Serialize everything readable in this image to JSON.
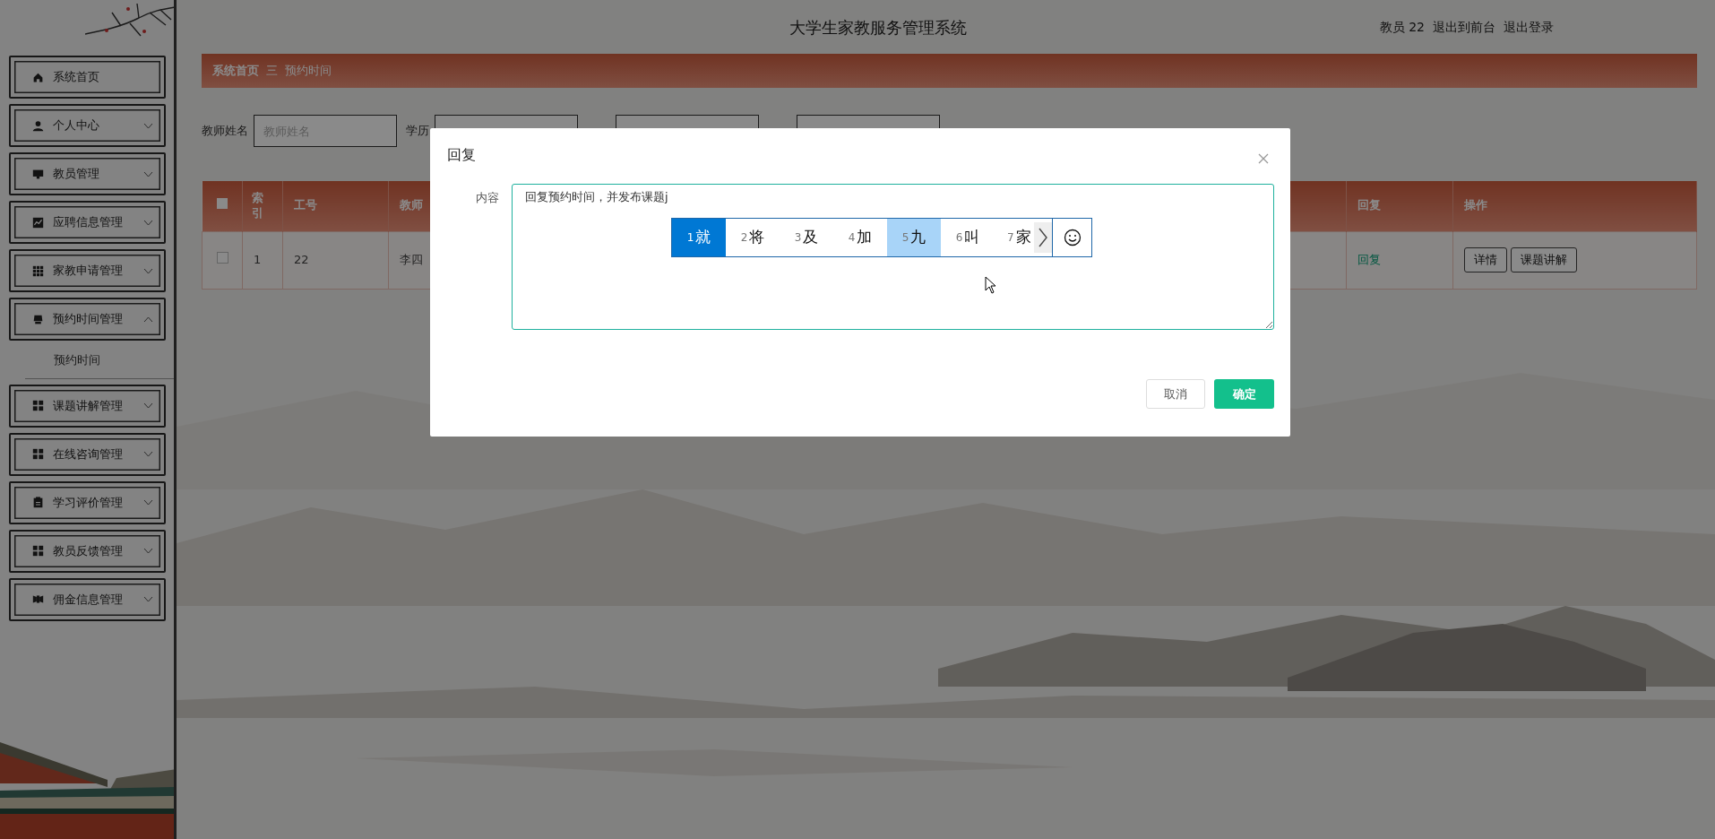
{
  "header": {
    "title": "大学生家教服务管理系统",
    "user": "教员 22",
    "links": [
      "退出到前台",
      "退出登录"
    ]
  },
  "sidebar": {
    "items": [
      {
        "kind": "link",
        "label": "系统首页"
      },
      {
        "kind": "menu",
        "label": "个人中心",
        "expanded": false
      },
      {
        "kind": "menu",
        "label": "教员管理",
        "expanded": false
      },
      {
        "kind": "menu",
        "label": "应聘信息管理",
        "expanded": false
      },
      {
        "kind": "menu",
        "label": "家教申请管理",
        "expanded": false
      },
      {
        "kind": "menu",
        "label": "预约时间管理",
        "expanded": true,
        "children": [
          {
            "label": "预约时间"
          }
        ]
      },
      {
        "kind": "menu",
        "label": "课题讲解管理",
        "expanded": false
      },
      {
        "kind": "menu",
        "label": "在线咨询管理",
        "expanded": false
      },
      {
        "kind": "menu",
        "label": "学习评价管理",
        "expanded": false
      },
      {
        "kind": "menu",
        "label": "教员反馈管理",
        "expanded": false
      },
      {
        "kind": "menu",
        "label": "佣金信息管理",
        "expanded": false
      }
    ]
  },
  "breadcrumb": {
    "items": [
      "系统首页",
      "预约时间"
    ],
    "separator": "三"
  },
  "search": {
    "fields": [
      {
        "label": "教师姓名",
        "placeholder": "教师姓名"
      },
      {
        "label": "学历"
      }
    ]
  },
  "table": {
    "select_all_checked": false,
    "columns": [
      "索引",
      "工号",
      "教师",
      "回复",
      "操作"
    ],
    "rows": [
      {
        "checked": false,
        "cells": [
          "1",
          "22",
          "李四"
        ],
        "reply_link": "回复",
        "actions": [
          "详情",
          "课题讲解"
        ]
      }
    ]
  },
  "dialog": {
    "title": "回复",
    "field_label": "内容",
    "value": "回复预约时间，并发布课题j",
    "ime": {
      "candidates": [
        {
          "num": "1",
          "char": "就",
          "selected": true,
          "hovered": false
        },
        {
          "num": "2",
          "char": "将",
          "selected": false,
          "hovered": false
        },
        {
          "num": "3",
          "char": "及",
          "selected": false,
          "hovered": false
        },
        {
          "num": "4",
          "char": "加",
          "selected": false,
          "hovered": false
        },
        {
          "num": "5",
          "char": "九",
          "selected": false,
          "hovered": true
        },
        {
          "num": "6",
          "char": "叫",
          "selected": false,
          "hovered": false
        },
        {
          "num": "7",
          "char": "家",
          "selected": false,
          "hovered": false
        }
      ]
    },
    "buttons": [
      {
        "kind": "cancel",
        "label": "取消"
      },
      {
        "kind": "confirm",
        "label": "确定"
      }
    ]
  }
}
